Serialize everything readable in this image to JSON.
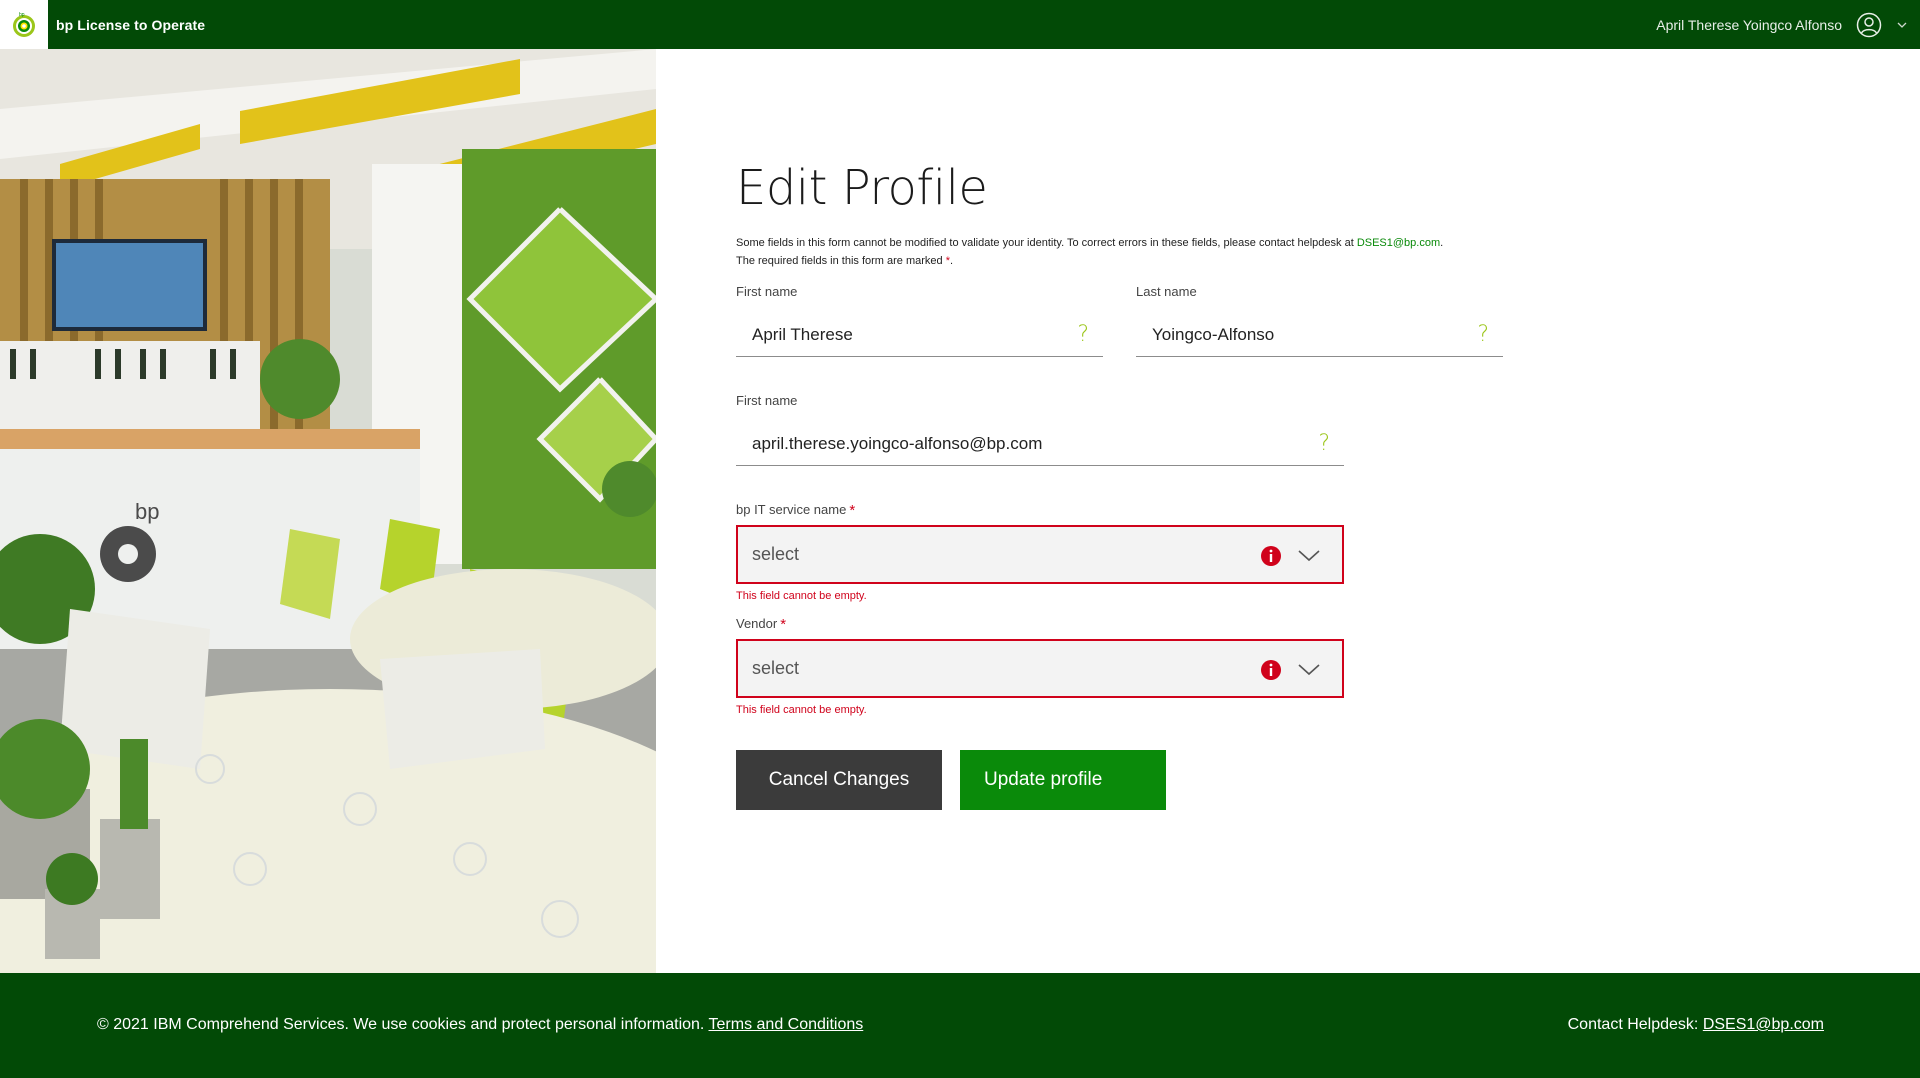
{
  "header": {
    "app_title": "bp License to Operate",
    "user_name": "April Therese Yoingco Alfonso"
  },
  "form": {
    "title": "Edit Profile",
    "note_line1_prefix": "Some fields in this form cannot be modified to validate your identity. To correct errors in these fields, please contact helpdesk at ",
    "note_email": "DSES1@bp.com",
    "note_line1_suffix": ".",
    "note_line2_prefix": "The required fields in this form are marked ",
    "note_required_mark": "*",
    "note_line2_suffix": ".",
    "first_name_label": "First name",
    "first_name_value": "April Therese",
    "last_name_label": "Last name",
    "last_name_value": "Yoingco-Alfonso",
    "email_label": "First name",
    "email_value": "april.therese.yoingco-alfonso@bp.com",
    "help_glyph": "?",
    "service_label": "bp IT service name",
    "service_placeholder": "select",
    "service_error": "This field cannot be empty.",
    "vendor_label": "Vendor",
    "vendor_placeholder": "select",
    "vendor_error": "This field cannot be empty.",
    "required_star": "*",
    "cancel_label": "Cancel Changes",
    "update_label": "Update profile"
  },
  "footer": {
    "copyright": "© 2021 IBM Comprehend Services. We use cookies and protect personal information. ",
    "terms_link": "Terms and Conditions",
    "contact_prefix": "Contact Helpdesk: ",
    "contact_email": "DSES1@bp.com"
  },
  "colors": {
    "brand_green_dark": "#024a06",
    "brand_green": "#0a8a0a",
    "error_red": "#d0021b",
    "help_lime": "#9bc61a"
  }
}
